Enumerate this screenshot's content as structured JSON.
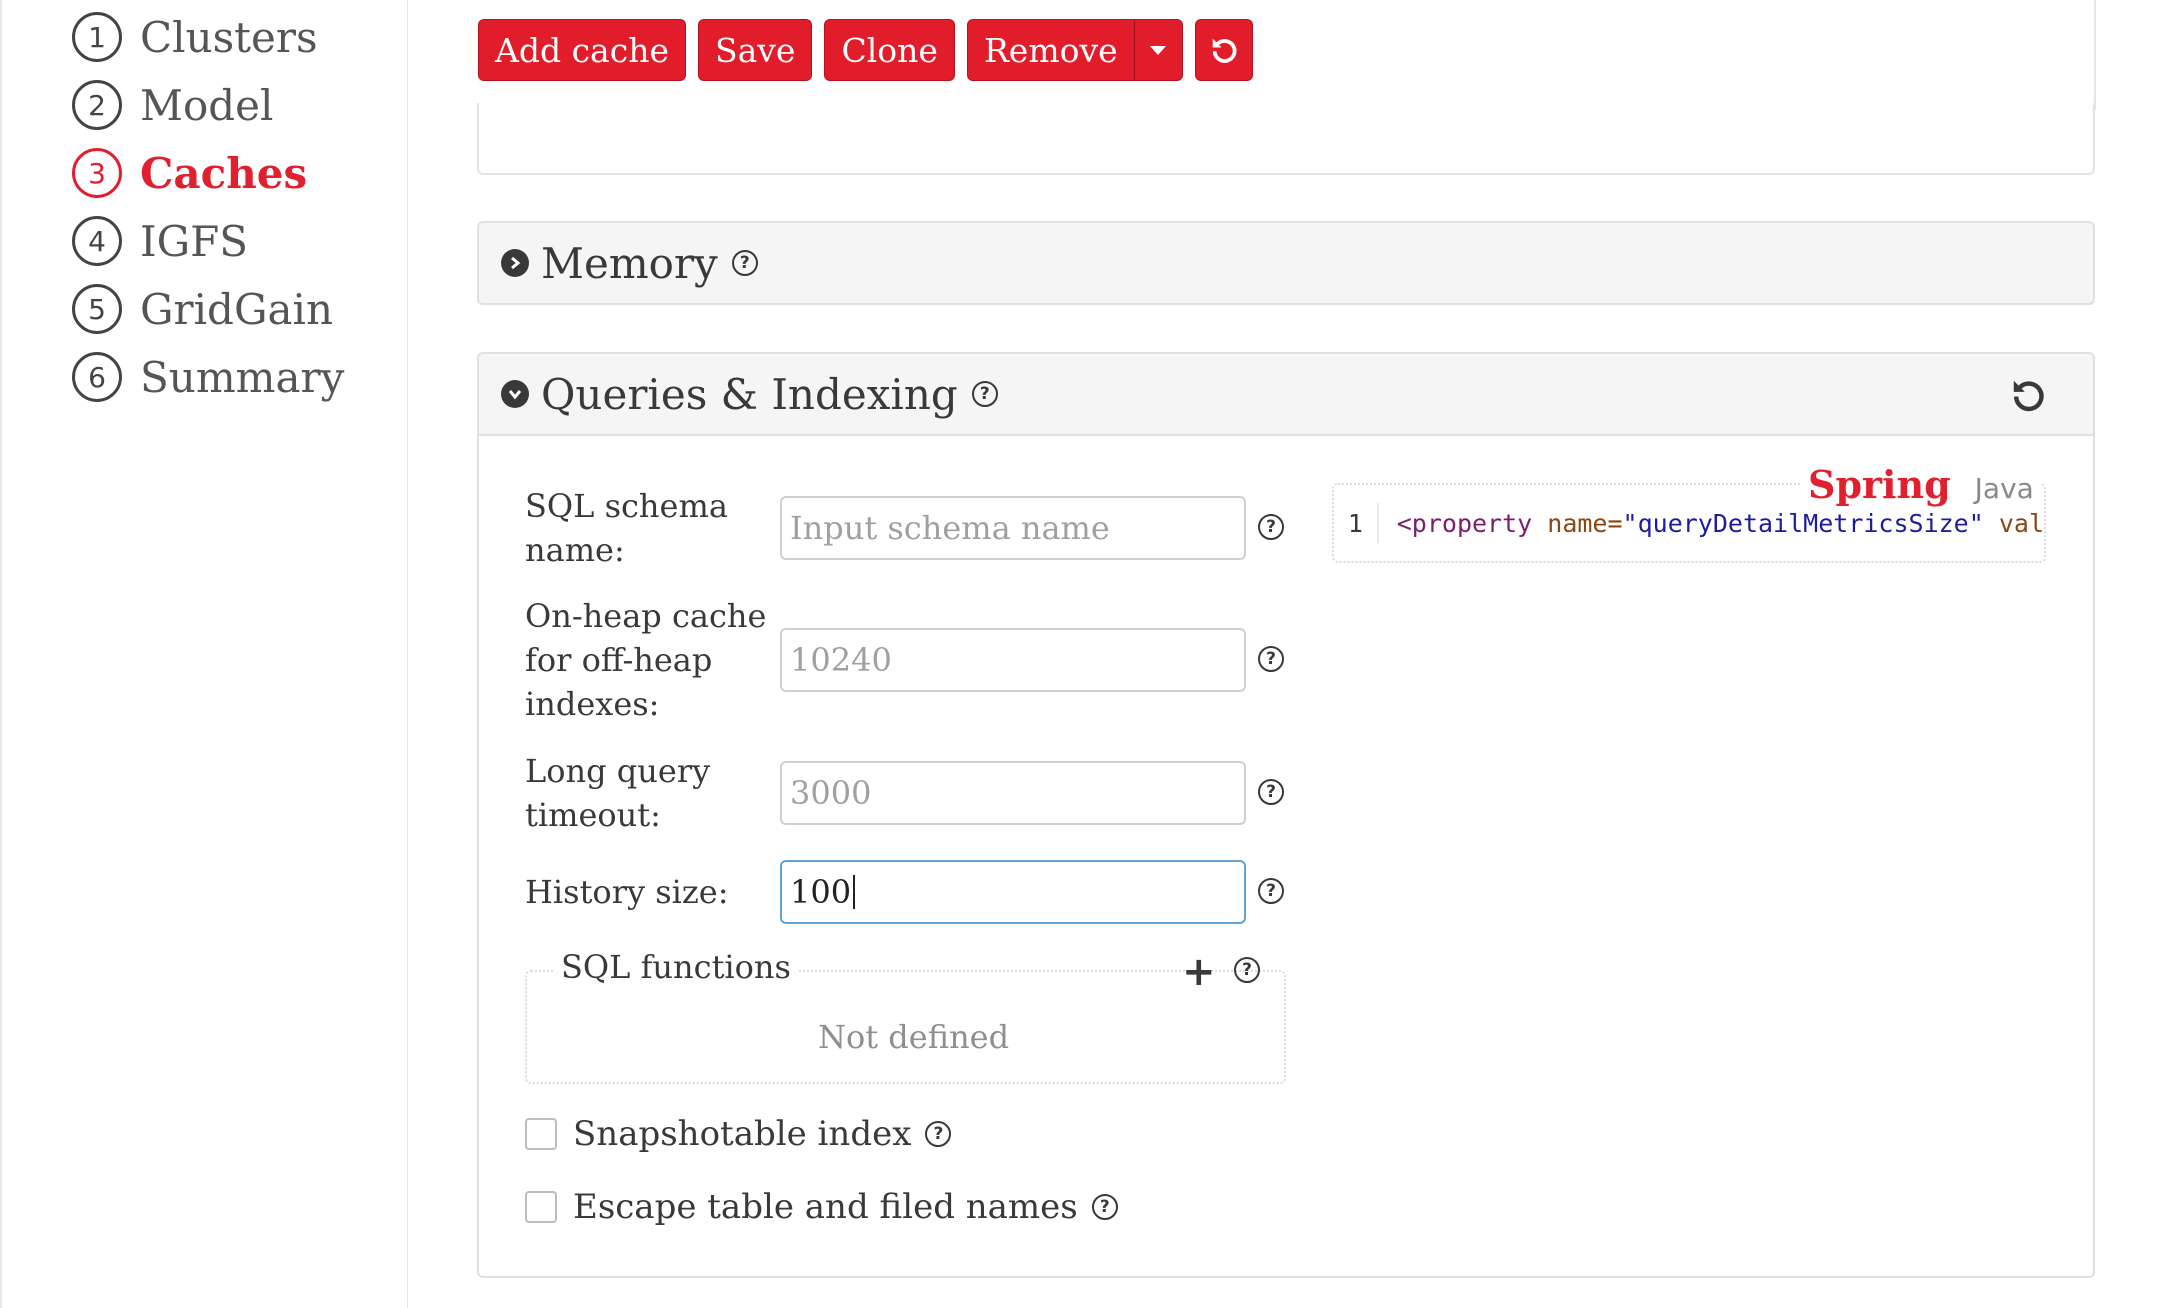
{
  "sidebar": {
    "items": [
      {
        "num": "1",
        "label": "Clusters"
      },
      {
        "num": "2",
        "label": "Model"
      },
      {
        "num": "3",
        "label": "Caches",
        "active": true
      },
      {
        "num": "4",
        "label": "IGFS"
      },
      {
        "num": "5",
        "label": "GridGain"
      },
      {
        "num": "6",
        "label": "Summary"
      }
    ]
  },
  "toolbar": {
    "add_cache": "Add cache",
    "save": "Save",
    "clone": "Clone",
    "remove": "Remove"
  },
  "memory": {
    "title": "Memory"
  },
  "queries": {
    "title": "Queries & Indexing",
    "fields": {
      "schema": {
        "label": "SQL schema name:",
        "placeholder": "Input schema name",
        "value": ""
      },
      "onheap": {
        "label": "On-heap cache for off-heap indexes:",
        "value": "10240"
      },
      "timeout": {
        "label": "Long query timeout:",
        "value": "3000"
      },
      "history": {
        "label": "History size:",
        "value": "100"
      }
    },
    "sql_functions": {
      "title": "SQL functions",
      "empty": "Not defined"
    },
    "checkboxes": {
      "snapshotable": "Snapshotable index",
      "escape": "Escape table and filed names"
    },
    "code": {
      "line_number": "1",
      "tag": "<property",
      "attr": "name=",
      "string": "\"queryDetailMetricsSize\"",
      "rest": "val",
      "tabs": {
        "spring": "Spring",
        "java": "Java"
      }
    }
  },
  "colors": {
    "accent": "#e11d2b",
    "focus": "#5ea2d9"
  },
  "icons": [
    "circle-number-icon",
    "chevron-right-icon",
    "chevron-down-icon",
    "help-icon",
    "undo-icon",
    "caret-down-icon",
    "plus-icon"
  ]
}
